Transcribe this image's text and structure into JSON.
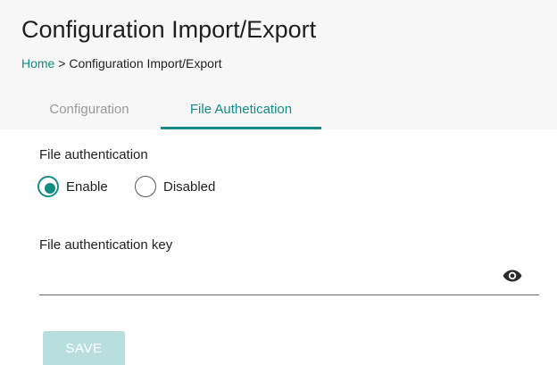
{
  "page": {
    "title": "Configuration Import/Export"
  },
  "breadcrumb": {
    "home": "Home",
    "separator": " > ",
    "current": "Configuration Import/Export"
  },
  "tabs": [
    {
      "label": "Configuration",
      "active": false
    },
    {
      "label": "File Authetication",
      "active": true
    }
  ],
  "form": {
    "auth_label": "File authentication",
    "radio_options": [
      {
        "label": "Enable",
        "selected": true
      },
      {
        "label": "Disabled",
        "selected": false
      }
    ],
    "key_label": "File authentication key",
    "key_value": "",
    "key_icon": "eye-icon"
  },
  "actions": {
    "save_label": "SAVE",
    "save_enabled": false
  },
  "colors": {
    "accent": "#148c86",
    "header_bg": "#f7f7f7",
    "save_disabled_bg": "#b8dfdd",
    "inactive_tab": "#9a9a9a"
  }
}
